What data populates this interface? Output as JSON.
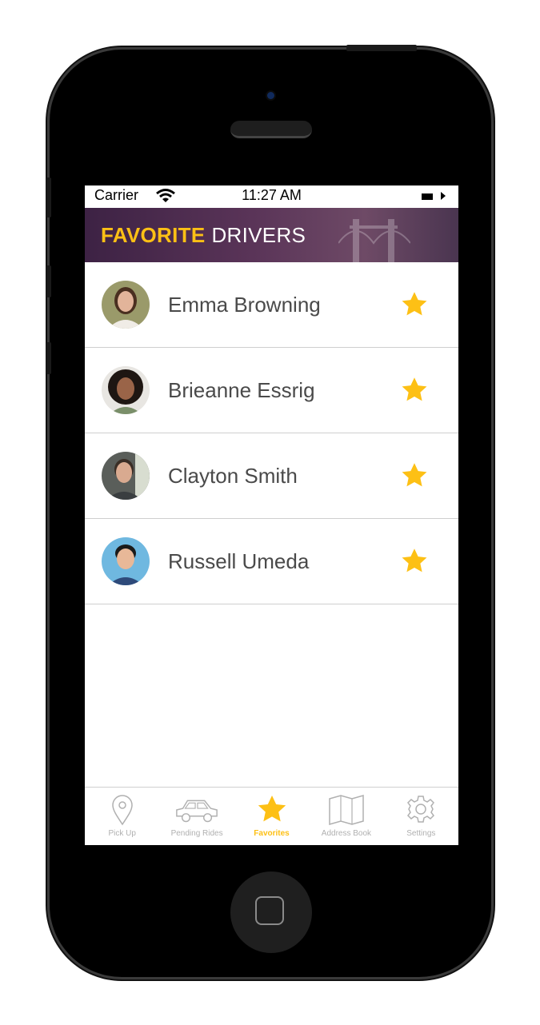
{
  "status": {
    "carrier": "Carrier",
    "time": "11:27 AM"
  },
  "header": {
    "title_highlight": "FAVORITE",
    "title_rest": "DRIVERS"
  },
  "drivers": [
    {
      "name": "Emma Browning"
    },
    {
      "name": "Brieanne Essrig"
    },
    {
      "name": "Clayton Smith"
    },
    {
      "name": "Russell Umeda"
    }
  ],
  "tabs": [
    {
      "label": "Pick Up",
      "icon": "location-pin-icon"
    },
    {
      "label": "Pending Rides",
      "icon": "car-icon"
    },
    {
      "label": "Favorites",
      "icon": "star-icon"
    },
    {
      "label": "Address Book",
      "icon": "book-icon"
    },
    {
      "label": "Settings",
      "icon": "gear-icon"
    }
  ],
  "colors": {
    "accent": "#fdc015",
    "header_bg": "#4e2d50",
    "text": "#4a4a4a",
    "tab_inactive": "#b0b0b0"
  }
}
